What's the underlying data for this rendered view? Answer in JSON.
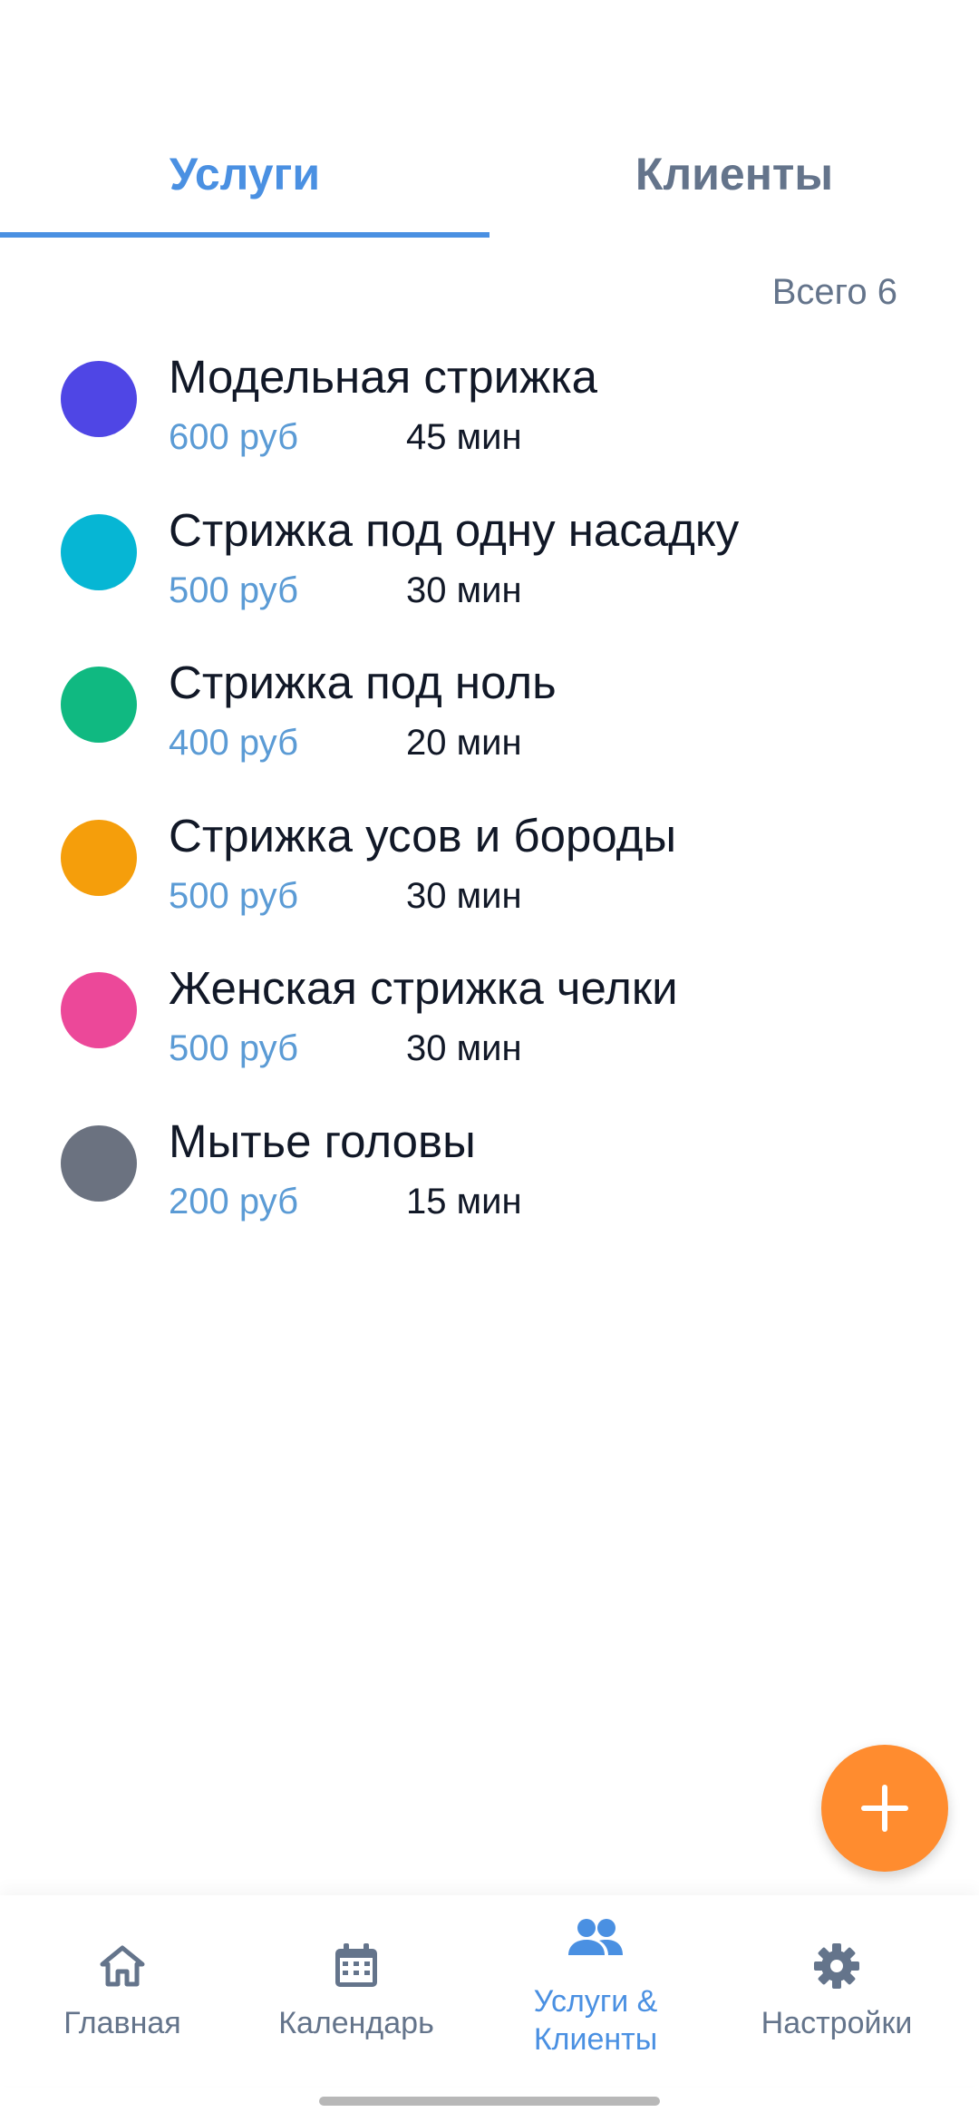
{
  "tabs": {
    "services": "Услуги",
    "clients": "Клиенты"
  },
  "total": "Всего 6",
  "services": [
    {
      "name": "Модельная стрижка",
      "price": "600 руб",
      "duration": "45 мин",
      "color": "#4f46e5"
    },
    {
      "name": "Стрижка под одну насадку",
      "price": "500 руб",
      "duration": "30 мин",
      "color": "#06b6d4"
    },
    {
      "name": "Стрижка под ноль",
      "price": "400 руб",
      "duration": "20 мин",
      "color": "#10b981"
    },
    {
      "name": "Стрижка усов и бороды",
      "price": "500 руб",
      "duration": "30 мин",
      "color": "#f59e0b"
    },
    {
      "name": "Женская стрижка челки",
      "price": "500 руб",
      "duration": "30 мин",
      "color": "#ec4899"
    },
    {
      "name": "Мытье головы",
      "price": "200 руб",
      "duration": "15 мин",
      "color": "#6b7280"
    }
  ],
  "fab": {
    "icon": "plus-icon",
    "color": "#ff8c2f"
  },
  "nav": {
    "home": {
      "label": "Главная",
      "icon": "home-icon"
    },
    "calendar": {
      "label": "Календарь",
      "icon": "calendar-icon"
    },
    "services_clients": {
      "label_line1": "Услуги &",
      "label_line2": "Клиенты",
      "icon": "people-icon"
    },
    "settings": {
      "label": "Настройки",
      "icon": "gear-icon"
    }
  },
  "colors": {
    "accent": "#4a90e2",
    "muted": "#64748b"
  }
}
